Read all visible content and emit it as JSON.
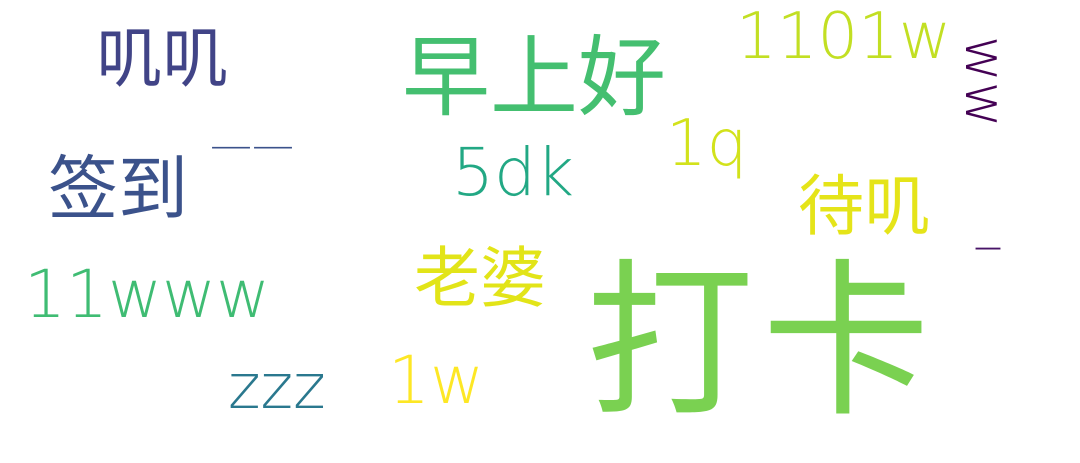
{
  "words": [
    {
      "text": "打卡",
      "color": "#7ad151"
    },
    {
      "text": "早上好",
      "color": "#44bf70"
    },
    {
      "text": "1101w",
      "color": "#c2df23"
    },
    {
      "text": "叽叽",
      "color": "#414487"
    },
    {
      "text": "签到",
      "color": "#3b528b"
    },
    {
      "text": "5dk",
      "color": "#22a884"
    },
    {
      "text": "1q",
      "color": "#d2e21b"
    },
    {
      "text": "待叽",
      "color": "#e5e419"
    },
    {
      "text": "老婆",
      "color": "#e2e418"
    },
    {
      "text": "11www",
      "color": "#3fbc73"
    },
    {
      "text": "zzz",
      "color": "#2a788e"
    },
    {
      "text": "1w",
      "color": "#fde725"
    },
    {
      "text": "ww",
      "color": "#440154"
    },
    {
      "text": "——",
      "color": "#3b528b"
    },
    {
      "text": "_",
      "color": "#481467"
    }
  ]
}
